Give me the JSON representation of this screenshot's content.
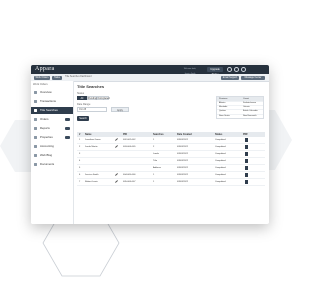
{
  "app": {
    "logo": "Appara"
  },
  "topbar": {
    "buttons": [
      "Upgrade Today",
      "Email Support",
      "Message Center"
    ],
    "status_text": "Welcome back, Jessica Smith"
  },
  "subbar": {
    "chips": [
      "Work Orders",
      "Tasks"
    ],
    "breadcrumb": "Title Searches Dashboard"
  },
  "sidebar": {
    "title": "Work Orders",
    "items": [
      {
        "label": "Overview",
        "badge": ""
      },
      {
        "label": "Transactions",
        "badge": ""
      },
      {
        "label": "Title Searches",
        "badge": "",
        "active": true
      },
      {
        "label": "Orders",
        "badge": "3"
      },
      {
        "label": "Reports",
        "badge": "5"
      },
      {
        "label": "Properties",
        "badge": "2"
      },
      {
        "label": "Accounting",
        "badge": ""
      },
      {
        "label": "Web Blog",
        "badge": ""
      },
      {
        "label": "Documents",
        "badge": ""
      }
    ]
  },
  "main": {
    "title": "Title Searches",
    "filter_label": "Status",
    "segments": [
      "All",
      "Pending",
      "Completed"
    ],
    "date_label": "Date Range",
    "date_value": "Oct 28",
    "apply_label": "Apply",
    "search_label": "Search",
    "filter_button": "Filter"
  },
  "summary_table": {
    "headers": [
      "Province",
      "Count"
    ],
    "rows": [
      [
        "Alberta",
        "Saskatchewan"
      ],
      [
        "Manitoba",
        "Ontario"
      ],
      [
        "Quebec",
        "British Columbia"
      ],
      [
        "Nova Scotia",
        "New Brunswick"
      ]
    ]
  },
  "grid": {
    "headers": [
      "#",
      "Name",
      "PID",
      "Searches",
      "Date Created",
      "Status",
      "PDF"
    ],
    "rows": [
      {
        "n": "1",
        "name": "Jonathan Green",
        "pid": "002-002-002",
        "s": "1",
        "date": "03/03/2022",
        "status": "Completed"
      },
      {
        "n": "2",
        "name": "Jacob Martin",
        "pid": "003-004-005",
        "s": "2",
        "date": "03/03/2022",
        "status": "Completed"
      },
      {
        "n": "3",
        "name": "",
        "pid": "",
        "s": "Lands",
        "date": "03/03/2022",
        "status": "Completed"
      },
      {
        "n": "4",
        "name": "",
        "pid": "",
        "s": "Title",
        "date": "03/03/2022",
        "status": "Completed"
      },
      {
        "n": "5",
        "name": "",
        "pid": "",
        "s": "Address",
        "date": "03/03/2022",
        "status": "Completed"
      },
      {
        "n": "6",
        "name": "Jessica Smith",
        "pid": "004-005-006",
        "s": "1",
        "date": "03/03/2022",
        "status": "Completed"
      },
      {
        "n": "7",
        "name": "Robert Lewis",
        "pid": "005-006-007",
        "s": "1",
        "date": "03/03/2022",
        "status": "Completed"
      }
    ]
  }
}
